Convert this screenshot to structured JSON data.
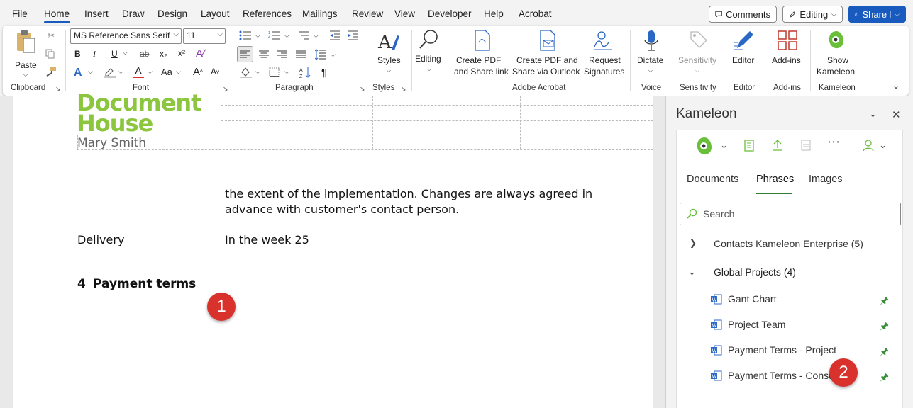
{
  "menu": [
    "File",
    "Home",
    "Insert",
    "Draw",
    "Design",
    "Layout",
    "References",
    "Mailings",
    "Review",
    "View",
    "Developer",
    "Help",
    "Acrobat"
  ],
  "top_buttons": {
    "comments": "Comments",
    "editing": "Editing",
    "share": "Share"
  },
  "ribbon": {
    "clipboard": {
      "paste": "Paste",
      "label": "Clipboard"
    },
    "font": {
      "family": "MS Reference Sans Serif",
      "size": "11",
      "label": "Font",
      "bold": "B",
      "italic": "I",
      "underline": "U",
      "strike": "ab",
      "sub": "x₂",
      "sup": "x²",
      "case": "Aa",
      "grow": "A",
      "shrink": "A"
    },
    "paragraph": {
      "label": "Paragraph"
    },
    "styles": {
      "button": "Styles",
      "label": "Styles"
    },
    "editing": {
      "button": "Editing"
    },
    "acrobat": {
      "create_pdf": [
        "Create PDF",
        "and Share link"
      ],
      "create_pdf_outlook": [
        "Create PDF and",
        "Share via Outlook"
      ],
      "request": [
        "Request",
        "Signatures"
      ],
      "label": "Adobe Acrobat"
    },
    "voice": {
      "dictate": "Dictate",
      "label": "Voice"
    },
    "sensitivity": {
      "button": "Sensitivity",
      "label": "Sensitivity"
    },
    "editor": {
      "button": "Editor",
      "label": "Editor"
    },
    "addins": {
      "button": "Add-ins",
      "label": "Add-ins"
    },
    "kameleon": {
      "button": [
        "Show",
        "Kameleon"
      ],
      "label": "Kameleon"
    }
  },
  "document": {
    "logo": [
      "Document",
      "House"
    ],
    "author": "Mary Smith",
    "para1": [
      "the extent of the implementation. Changes are always agreed in",
      "advance with customer's contact person."
    ],
    "delivery_label": "Delivery",
    "delivery_value": "In the week 25",
    "heading_num": "4",
    "heading": "Payment terms"
  },
  "badges": [
    "1",
    "2"
  ],
  "pane": {
    "title": "Kameleon",
    "tabs": [
      "Documents",
      "Phrases",
      "Images"
    ],
    "search_placeholder": "Search",
    "groups": [
      {
        "name": "Contacts Kameleon Enterprise (5)",
        "expanded": false
      },
      {
        "name": "Global Projects (4)",
        "expanded": true
      }
    ],
    "phrases": [
      "Gant Chart",
      "Project Team",
      "Payment Terms - Project",
      "Payment Terms - Consu"
    ]
  },
  "colors": {
    "accent": "#185abd",
    "kameleon_green": "#6abf3a",
    "logo_green": "#8cc63f",
    "badge": "#d9322d"
  }
}
